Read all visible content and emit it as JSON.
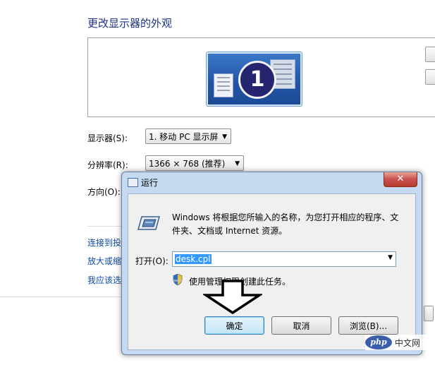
{
  "background": {
    "title": "更改显示器的外观",
    "monitor_number": "1",
    "display_label": "显示器(S):",
    "display_value": "1. 移动 PC 显示屏",
    "resolution_label": "分辨率(R):",
    "resolution_value": "1366 × 768 (推荐)",
    "orientation_label": "方向(O):",
    "links": [
      "连接到投",
      "放大或缩",
      "我应该选"
    ]
  },
  "dialog": {
    "title": "运行",
    "close": "✕",
    "description": "Windows 将根据您所输入的名称，为您打开相应的程序、文件夹、文档或 Internet 资源。",
    "open_label": "打开(O):",
    "command_value": "desk.cpl",
    "admin_text": "使用管理权限创建此任务。",
    "buttons": {
      "ok": "确定",
      "cancel": "取消",
      "browse": "浏览(B)..."
    }
  },
  "watermark": {
    "logo": "php",
    "text": "中文网"
  },
  "colors": {
    "title_blue": "#1e3287",
    "link_blue": "#0b4aa6",
    "dialog_frame": "#c5d9f1",
    "selection": "#3399ff"
  }
}
